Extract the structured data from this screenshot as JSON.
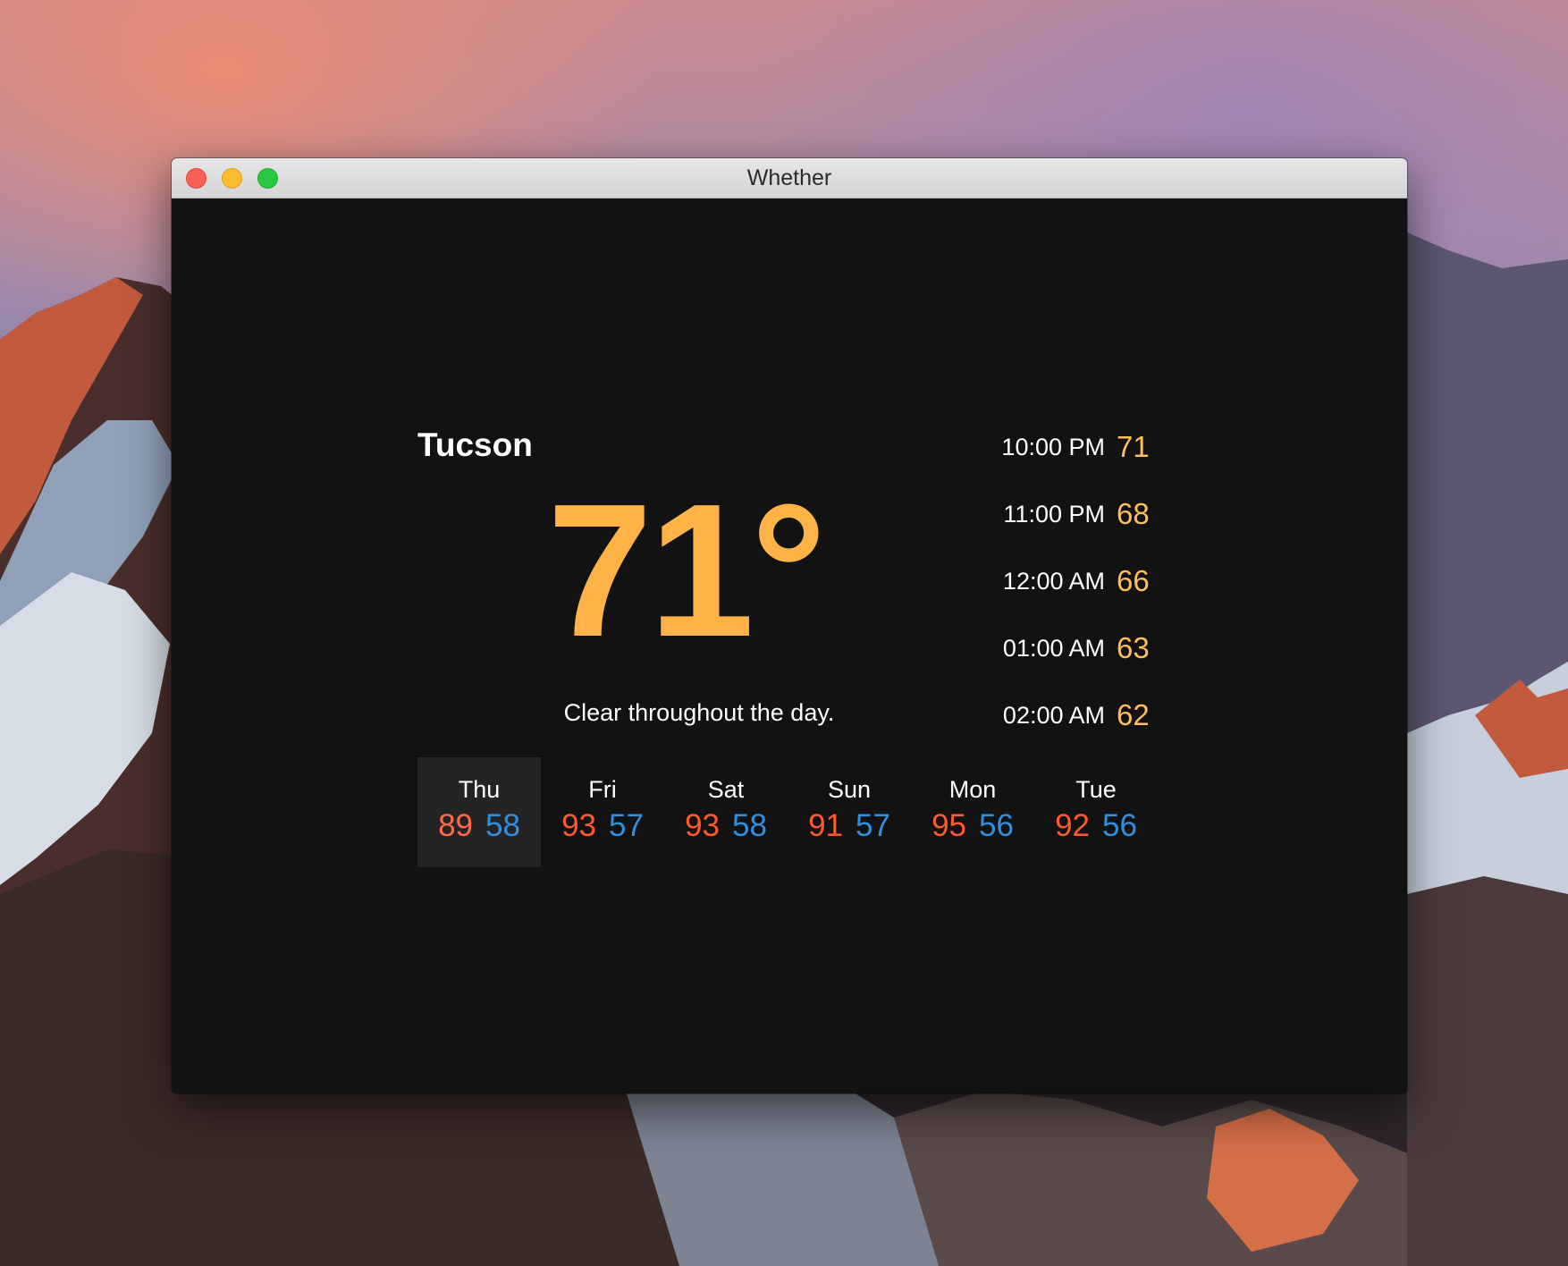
{
  "window": {
    "title": "Whether"
  },
  "weather": {
    "city": "Tucson",
    "current_temp": "71°",
    "summary": "Clear throughout the day."
  },
  "hourly": [
    {
      "time": "10:00 PM",
      "temp": "71"
    },
    {
      "time": "11:00 PM",
      "temp": "68"
    },
    {
      "time": "12:00 AM",
      "temp": "66"
    },
    {
      "time": "01:00 AM",
      "temp": "63"
    },
    {
      "time": "02:00 AM",
      "temp": "62"
    }
  ],
  "daily": [
    {
      "day": "Thu",
      "high": "89",
      "low": "58",
      "selected": true
    },
    {
      "day": "Fri",
      "high": "93",
      "low": "57",
      "selected": false
    },
    {
      "day": "Sat",
      "high": "93",
      "low": "58",
      "selected": false
    },
    {
      "day": "Sun",
      "high": "91",
      "low": "57",
      "selected": false
    },
    {
      "day": "Mon",
      "high": "95",
      "low": "56",
      "selected": false
    },
    {
      "day": "Tue",
      "high": "92",
      "low": "56",
      "selected": false
    }
  ],
  "colors": {
    "current_temp": "#ffb347",
    "hourly_temp": "#ffbe5c",
    "high": "#ff5a2d",
    "low": "#2f8fe0",
    "window_bg": "#121212"
  }
}
